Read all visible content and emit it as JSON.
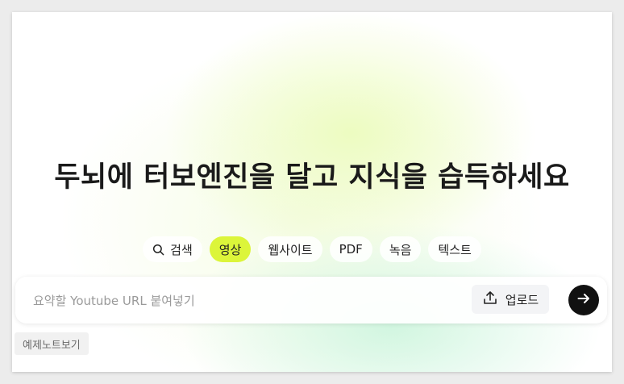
{
  "hero": {
    "headline": "두뇌에 터보엔진을 달고 지식을 습득하세요"
  },
  "tabs": [
    {
      "label": "검색",
      "icon": "search-icon",
      "active": false
    },
    {
      "label": "영상",
      "active": true
    },
    {
      "label": "웹사이트",
      "active": false
    },
    {
      "label": "PDF",
      "active": false
    },
    {
      "label": "녹음",
      "active": false
    },
    {
      "label": "텍스트",
      "active": false
    }
  ],
  "input": {
    "placeholder": "요약할 Youtube URL 붙여넣기",
    "value": ""
  },
  "upload": {
    "label": "업로드",
    "icon": "upload-icon"
  },
  "submit": {
    "icon": "arrow-right-icon"
  },
  "example": {
    "label": "예제노트보기"
  },
  "colors": {
    "accent": "#dcf53a",
    "submit_bg": "#111111"
  }
}
